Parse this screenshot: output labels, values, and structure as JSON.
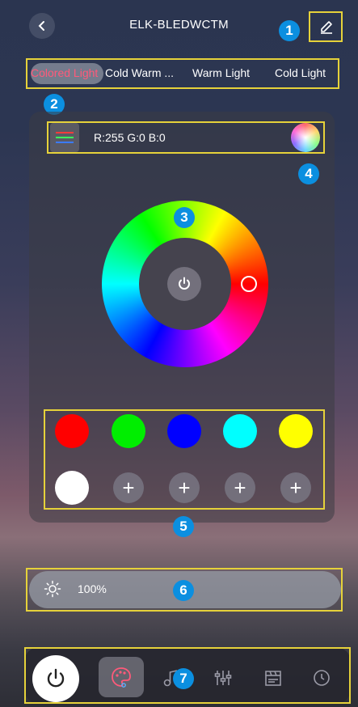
{
  "header": {
    "title": "ELK-BLEDWCTM",
    "back_icon": "chevron-left-icon",
    "edit_icon": "pencil-icon"
  },
  "tabs": [
    {
      "label": "Colored Light",
      "active": true
    },
    {
      "label": "Cold Warm ...",
      "active": false
    },
    {
      "label": "Warm Light",
      "active": false
    },
    {
      "label": "Cold Light",
      "active": false
    }
  ],
  "color": {
    "rgb_text": "R:255 G:0 B:0"
  },
  "presets": {
    "colors": [
      "#ff0000",
      "#00ee00",
      "#0000ff",
      "#00ffff",
      "#ffff00",
      "#ffffff"
    ],
    "add_label": "+"
  },
  "brightness": {
    "value": "100%"
  },
  "nav": {
    "items": [
      "power-icon",
      "palette-icon",
      "music-icon",
      "sliders-icon",
      "scene-icon",
      "clock-icon"
    ]
  },
  "callouts": [
    "1",
    "2",
    "3",
    "4",
    "5",
    "6",
    "7"
  ],
  "colors": {
    "callout": "#0b8fe0",
    "highlight_box": "#e6d23a",
    "active_tab_text": "#ff5a7a"
  }
}
